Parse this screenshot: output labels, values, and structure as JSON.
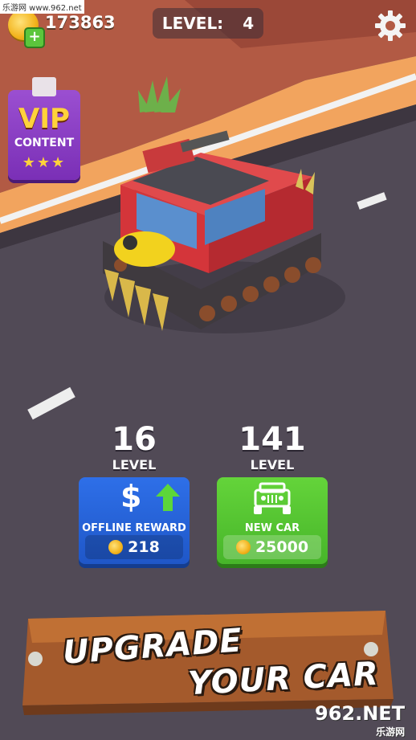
{
  "watermark": {
    "top": "乐游网 www.962.net",
    "brand": "962.NET",
    "brand_sub": "乐游网"
  },
  "hud": {
    "currency": "173863",
    "level_label": "LEVEL:",
    "level_value": "4",
    "settings_icon": "gear-icon"
  },
  "vip": {
    "title": "VIP",
    "subtitle": "CONTENT",
    "stars": "★★★"
  },
  "upgrades": {
    "offline": {
      "level": "16",
      "level_label": "LEVEL",
      "caption": "OFFLINE REWARD",
      "price": "218",
      "icon": "dollar-arrow-icon"
    },
    "newcar": {
      "level": "141",
      "level_label": "LEVEL",
      "caption": "NEW CAR",
      "price": "25000",
      "icon": "jeep-icon"
    }
  },
  "banner": {
    "line1": "UPGRADE",
    "line2": "YOUR CAR"
  },
  "colors": {
    "blue_button": "#2e6fe8",
    "green_button": "#5cc63c",
    "vip_purple": "#8a3fc4",
    "road": "#514a56",
    "sand": "#f2a45e"
  }
}
